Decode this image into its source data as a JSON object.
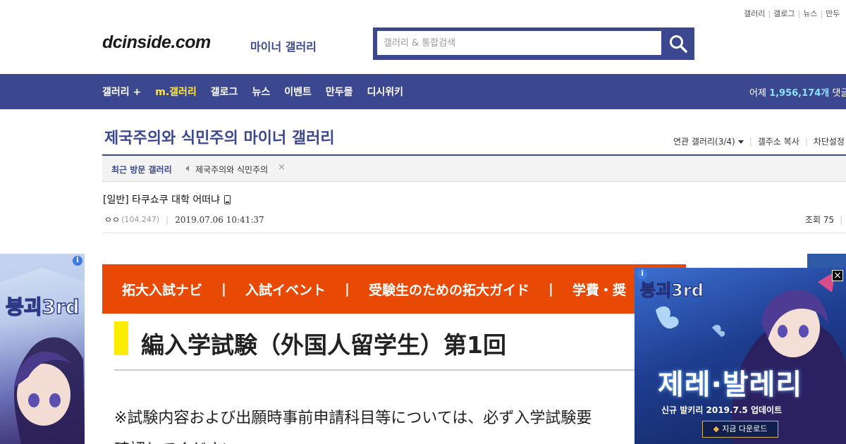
{
  "util_links": [
    "갤러리",
    "갤로그",
    "뉴스",
    "만두"
  ],
  "header": {
    "logo": "dcinside.com",
    "logo_sub": "마이너 갤러리",
    "search_placeholder": "갤러리 & 통합검색"
  },
  "nav": {
    "items": [
      "갤러리 +",
      "m.갤러리",
      "갤로그",
      "뉴스",
      "이벤트",
      "만두몰",
      "디시위키"
    ],
    "right_prefix": "어제",
    "right_count": "1,956,174개",
    "right_suffix": "댓글"
  },
  "gallery": {
    "title": "제국주의와 식민주의 마이너 갤러리",
    "related": "연관 갤러리(3/4)",
    "copy_address": "갤주소 복사",
    "block_settings": "차단설정"
  },
  "recent": {
    "label": "최근 방문 갤러리",
    "item": "제국주의와 식민주의",
    "close": "×"
  },
  "post": {
    "title": "[일반] 타쿠쇼쿠 대학 어떠냐",
    "author": "ㅇㅇ",
    "ip": "(104.247)",
    "date": "2019.07.06 10:41:37",
    "views": "조회 75"
  },
  "content": {
    "banner": [
      "拓大入試ナビ",
      "入試イベント",
      "受験生のための拓大ガイド",
      "学費・奨"
    ],
    "heading": "編入学試験（外国人留学生）第1回",
    "body": "※試験内容および出願時事前申請科目等については、必ず入学試験要",
    "body2": "確認してください"
  },
  "ad": {
    "info": "i",
    "close": "×",
    "title": "제레·발레리",
    "subtitle": "신규 발키리 2019.7.5 업데이트",
    "button": "지금 다운로드",
    "logo_text": "붕괴3rd"
  },
  "colors": {
    "brand": "#3b4890",
    "nav_highlight": "#ffe640",
    "banner": "#e84a05",
    "accent_yellow": "#ffed00"
  }
}
